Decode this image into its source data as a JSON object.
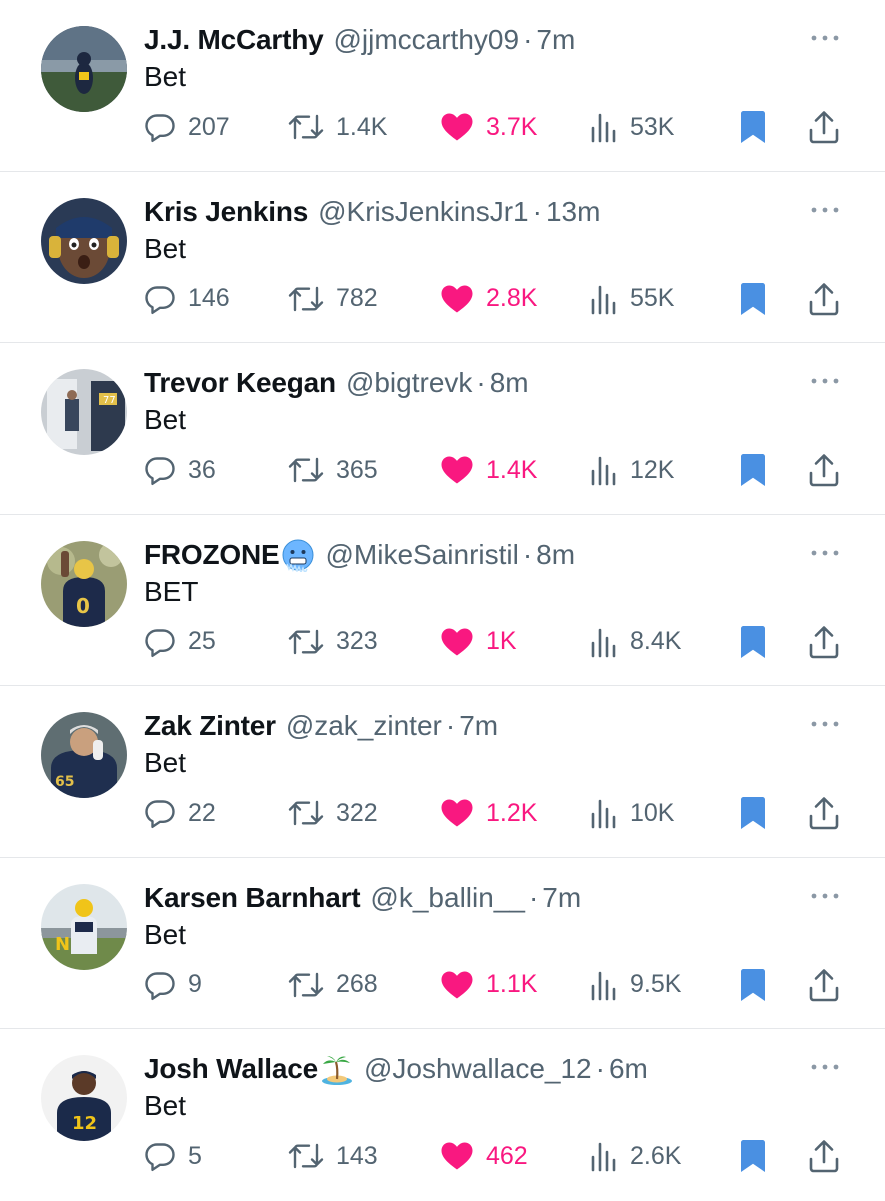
{
  "colors": {
    "like_accent": "#f91880",
    "bookmark_accent": "#4a90e2",
    "secondary_text": "#536471",
    "primary_text": "#0f1419",
    "divider": "#e5e7ea"
  },
  "tweets": [
    {
      "display_name": "J.J. McCarthy",
      "handle": "@jjmccarthy09",
      "separator": "·",
      "time": "7m",
      "text": "Bet",
      "replies": "207",
      "retweets": "1.4K",
      "likes": "3.7K",
      "views": "53K",
      "liked": true,
      "bookmarked": true,
      "emoji": ""
    },
    {
      "display_name": "Kris Jenkins",
      "handle": "@KrisJenkinsJr1",
      "separator": "·",
      "time": "13m",
      "text": "Bet",
      "replies": "146",
      "retweets": "782",
      "likes": "2.8K",
      "views": "55K",
      "liked": true,
      "bookmarked": true,
      "emoji": ""
    },
    {
      "display_name": "Trevor Keegan",
      "handle": "@bigtrevk",
      "separator": "·",
      "time": "8m",
      "text": "Bet",
      "replies": "36",
      "retweets": "365",
      "likes": "1.4K",
      "views": "12K",
      "liked": true,
      "bookmarked": true,
      "emoji": ""
    },
    {
      "display_name": "FROZONE",
      "handle": "@MikeSainristil",
      "separator": "·",
      "time": "8m",
      "text": "BET",
      "replies": "25",
      "retweets": "323",
      "likes": "1K",
      "views": "8.4K",
      "liked": true,
      "bookmarked": true,
      "emoji": "cold-face-emoji"
    },
    {
      "display_name": "Zak Zinter",
      "handle": "@zak_zinter",
      "separator": "·",
      "time": "7m",
      "text": "Bet",
      "replies": "22",
      "retweets": "322",
      "likes": "1.2K",
      "views": "10K",
      "liked": true,
      "bookmarked": true,
      "emoji": ""
    },
    {
      "display_name": "Karsen Barnhart",
      "handle": "@k_ballin__",
      "separator": "·",
      "time": "7m",
      "text": "Bet",
      "replies": "9",
      "retweets": "268",
      "likes": "1.1K",
      "views": "9.5K",
      "liked": true,
      "bookmarked": true,
      "emoji": ""
    },
    {
      "display_name": "Josh Wallace",
      "handle": "@Joshwallace_12",
      "separator": "·",
      "time": "6m",
      "text": "Bet",
      "replies": "5",
      "retweets": "143",
      "likes": "462",
      "views": "2.6K",
      "liked": true,
      "bookmarked": true,
      "emoji": "desert-island-emoji"
    }
  ]
}
